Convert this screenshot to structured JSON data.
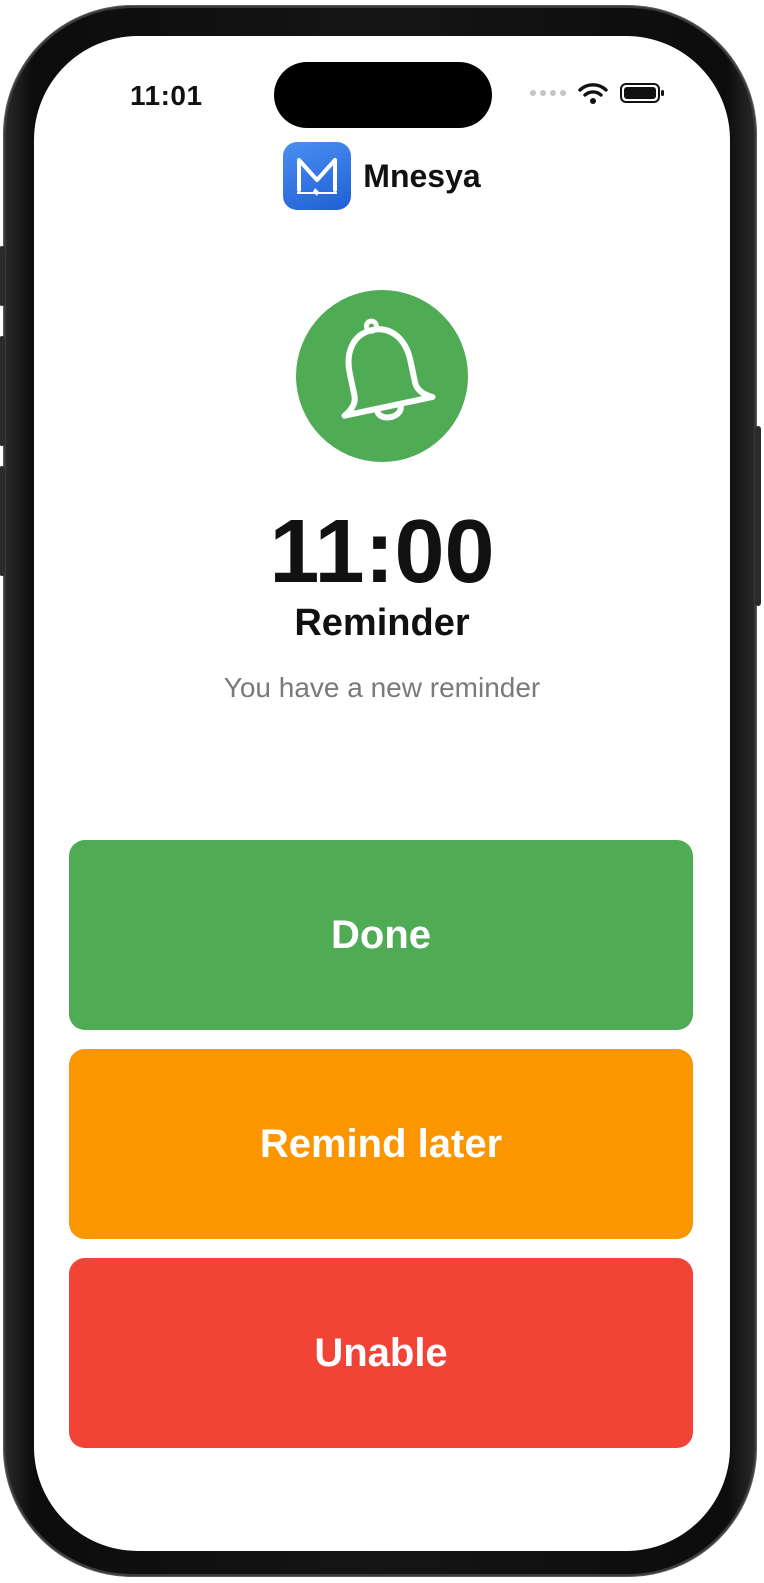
{
  "status_bar": {
    "time": "11:01"
  },
  "brand": {
    "name": "Mnesya",
    "logo_color": "#2a6fe0"
  },
  "reminder": {
    "icon": "bell-icon",
    "icon_bg_color": "#4fac55",
    "time": "11:00",
    "title": "Reminder",
    "message": "You have a new reminder"
  },
  "actions": {
    "done": {
      "label": "Done",
      "color": "#4fac55"
    },
    "remind_later": {
      "label": "Remind later",
      "color": "#fb9500"
    },
    "unable": {
      "label": "Unable",
      "color": "#f14336"
    }
  }
}
